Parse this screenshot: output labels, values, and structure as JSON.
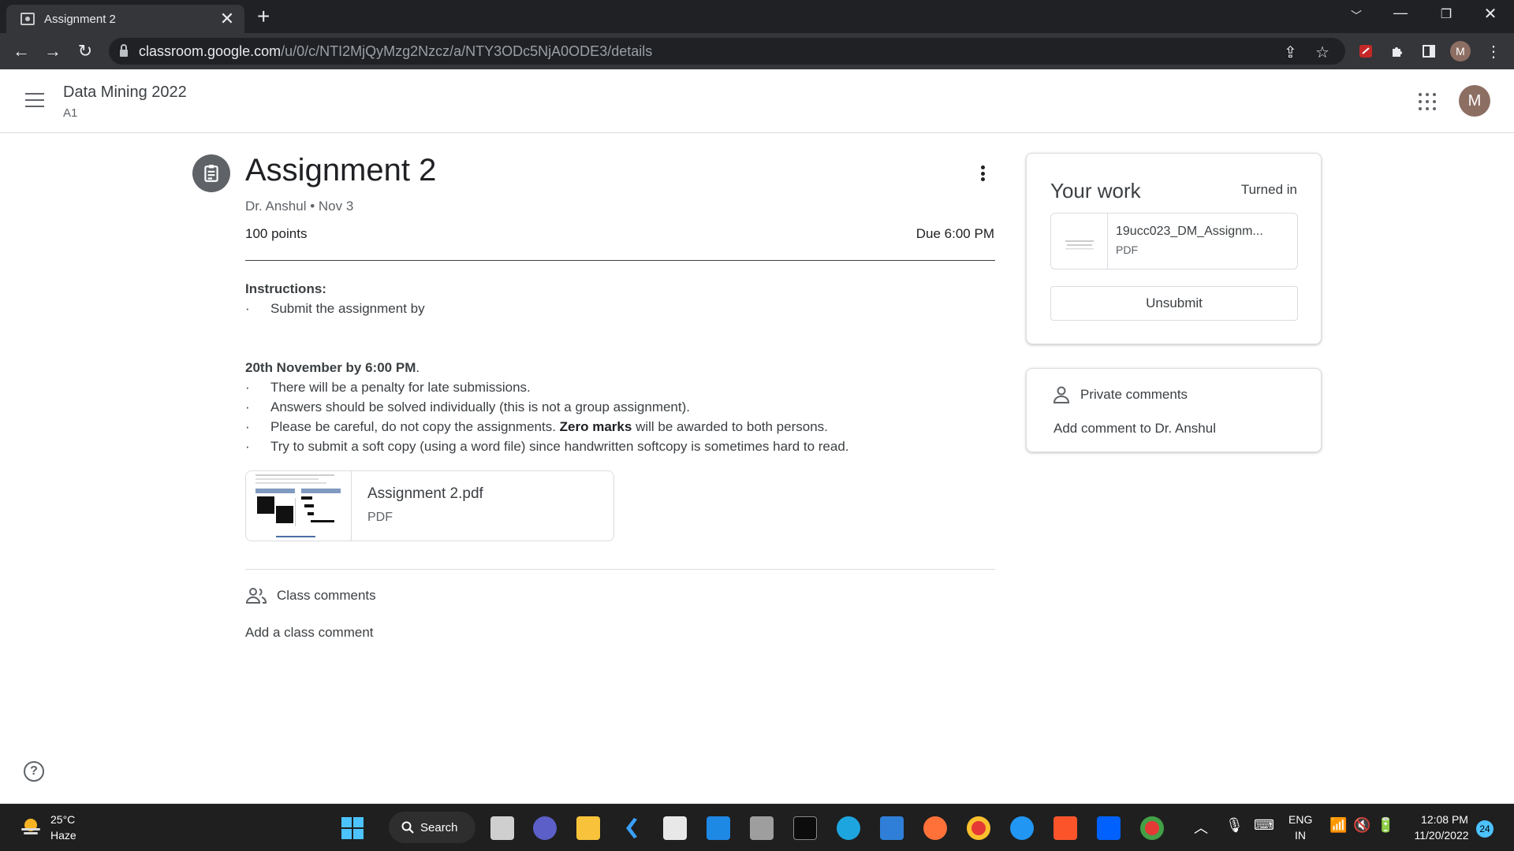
{
  "browser": {
    "tab_title": "Assignment 2",
    "tab_close": "✕",
    "new_tab": "+",
    "url_host": "classroom.google.com",
    "url_path": "/u/0/c/NTI2MjQyMzg2Nzcz/a/NTY3ODc5NjA0ODE3/details",
    "profile_initial": "M"
  },
  "header": {
    "course_title": "Data Mining 2022",
    "course_section": "A1",
    "account_initial": "M"
  },
  "assignment": {
    "title": "Assignment 2",
    "author": "Dr. Anshul",
    "date": "Nov 3",
    "separator": " • ",
    "points": "100 points",
    "due": "Due 6:00 PM",
    "instructions_heading": "Instructions:",
    "bullet_char": "·",
    "first_bullet": "Submit the assignment by",
    "deadline_bold": "20th November by 6:00 PM",
    "deadline_tail": ".",
    "bullets": [
      "There will be a penalty for late submissions.",
      "Answers should be solved individually (this is not a group assignment)."
    ],
    "careful_pre": "Please be careful, do not copy the assignments. ",
    "careful_bold": "Zero marks",
    "careful_post": " will be awarded to both persons.",
    "last_bullet": "Try to submit a soft copy (using a word file) since handwritten softcopy is sometimes hard to read.",
    "attachment": {
      "name": "Assignment 2.pdf",
      "type": "PDF"
    },
    "class_comments_label": "Class comments",
    "add_class_comment": "Add a class comment"
  },
  "your_work": {
    "title": "Your work",
    "status": "Turned in",
    "file": {
      "name": "19ucc023_DM_Assignm...",
      "type": "PDF"
    },
    "unsubmit_label": "Unsubmit"
  },
  "private_comments": {
    "label": "Private comments",
    "add": "Add comment to Dr. Anshul"
  },
  "help": "?",
  "taskbar": {
    "temperature": "25°C",
    "weather": "Haze",
    "search_label": "Search",
    "language": "ENG",
    "region": "IN",
    "time": "12:08 PM",
    "date": "11/20/2022",
    "notifications": "24"
  },
  "colors": {
    "chrome_dark": "#202124",
    "chrome_toolbar": "#35363a",
    "avatar": "#8d6e63",
    "text": "#3c4043",
    "taskbar": "#1f1f1f",
    "badge": "#4cc2ff"
  },
  "icons": {
    "assignment": "assignment-clipboard-icon",
    "class_comments": "people-icon",
    "private_comments": "person-icon",
    "apps": "apps-grid-icon",
    "kebab": "more-vert-icon"
  }
}
